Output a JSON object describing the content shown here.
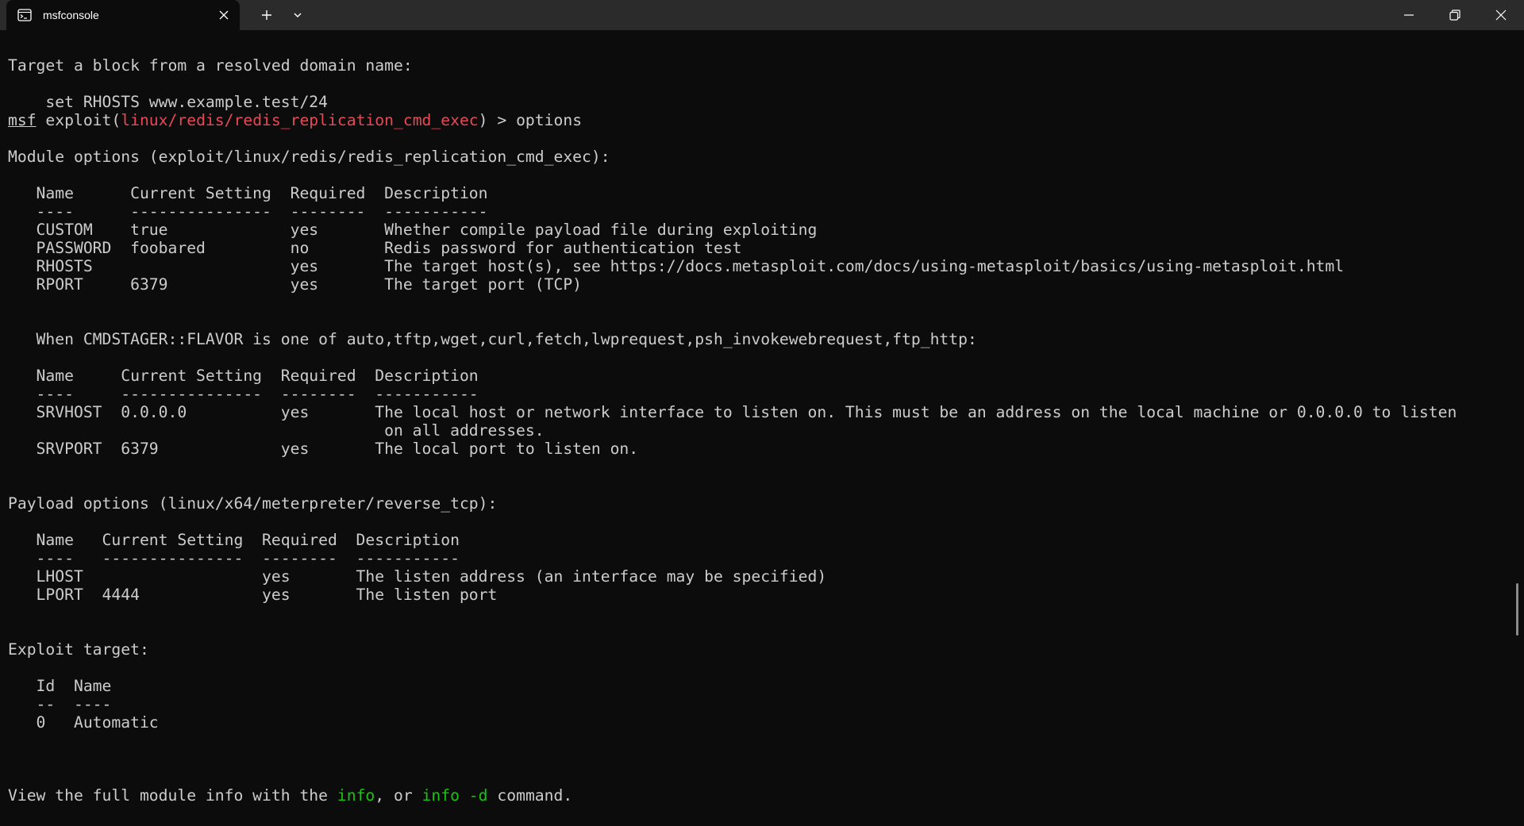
{
  "window": {
    "tab_title": "msfconsole",
    "icons": {
      "tab": "terminal-icon",
      "tab_close": "close-icon",
      "new_tab": "plus-icon",
      "dropdown": "chevron-down-icon",
      "minimize": "minimize-icon",
      "maximize": "restore-icon",
      "close": "close-icon"
    }
  },
  "colors": {
    "background": "#0c0c0c",
    "foreground": "#cccccc",
    "titlebar": "#2b2b2b",
    "module_path": "#e74856",
    "command_highlight": "#16c60c"
  },
  "terminal": {
    "target_block_heading": "Target a block from a resolved domain name:",
    "set_rhosts_example": "    set RHOSTS www.example.test/24",
    "prompt_user": "msf",
    "prompt_exploit_open": " exploit(",
    "prompt_module": "linux/redis/redis_replication_cmd_exec",
    "prompt_close_and_command": ") > options",
    "module_options_heading": "Module options (exploit/linux/redis/redis_replication_cmd_exec):",
    "module_table": {
      "header": "   Name      Current Setting  Required  Description",
      "underline": "   ----      ---------------  --------  -----------",
      "rows": [
        "   CUSTOM    true             yes       Whether compile payload file during exploiting",
        "   PASSWORD  foobared         no        Redis password for authentication test",
        "   RHOSTS                     yes       The target host(s), see https://docs.metasploit.com/docs/using-metasploit/basics/using-metasploit.html",
        "   RPORT     6379             yes       The target port (TCP)"
      ]
    },
    "cmdstager_heading": "   When CMDSTAGER::FLAVOR is one of auto,tftp,wget,curl,fetch,lwprequest,psh_invokewebrequest,ftp_http:",
    "cmdstager_table": {
      "header": "   Name     Current Setting  Required  Description",
      "underline": "   ----     ---------------  --------  -----------",
      "rows": [
        "   SRVHOST  0.0.0.0          yes       The local host or network interface to listen on. This must be an address on the local machine or 0.0.0.0 to listen",
        "                                        on all addresses.",
        "   SRVPORT  6379             yes       The local port to listen on."
      ]
    },
    "payload_heading": "Payload options (linux/x64/meterpreter/reverse_tcp):",
    "payload_table": {
      "header": "   Name   Current Setting  Required  Description",
      "underline": "   ----   ---------------  --------  -----------",
      "rows": [
        "   LHOST                   yes       The listen address (an interface may be specified)",
        "   LPORT  4444             yes       The listen port"
      ]
    },
    "exploit_target_heading": "Exploit target:",
    "target_table": {
      "header": "   Id  Name",
      "underline": "   --  ----",
      "rows": [
        "   0   Automatic"
      ]
    },
    "footer_prefix": "View the full module info with the ",
    "footer_info": "info",
    "footer_or": ", or ",
    "footer_info_d": "info -d",
    "footer_suffix": " command."
  }
}
